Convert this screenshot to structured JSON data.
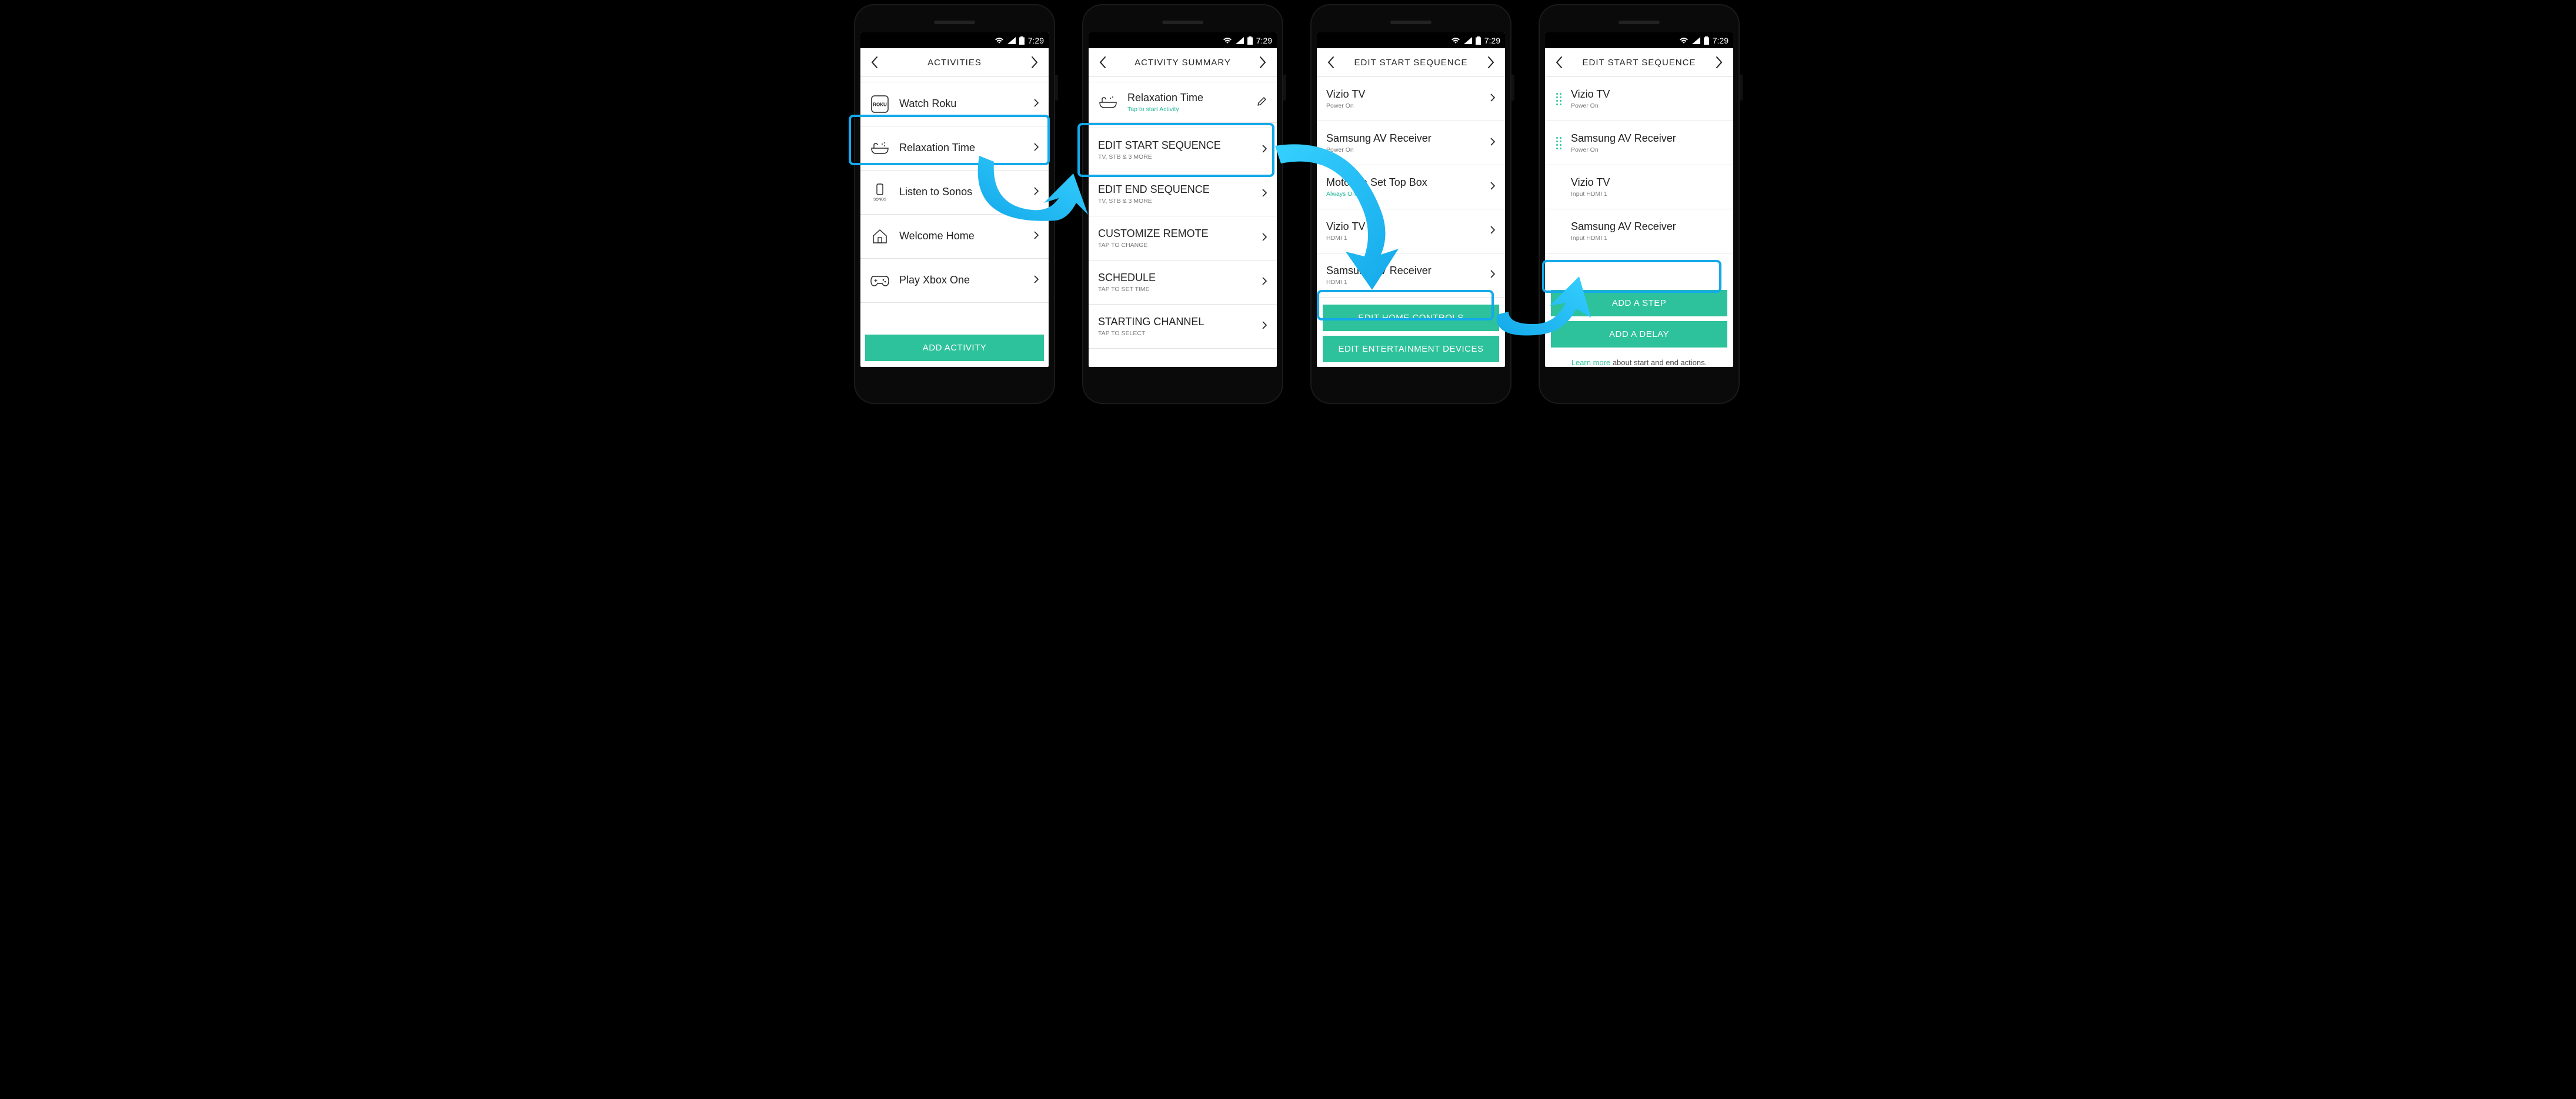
{
  "status": {
    "time": "7:29"
  },
  "colors": {
    "accent": "#2dc29b",
    "highlight": "#14a9ea"
  },
  "screen1": {
    "title": "ACTIVITIES",
    "items": [
      {
        "label": "Watch Roku",
        "icon": "roku"
      },
      {
        "label": "Relaxation Time",
        "icon": "bath"
      },
      {
        "label": "Listen to Sonos",
        "icon": "sonos"
      },
      {
        "label": "Welcome Home",
        "icon": "home"
      },
      {
        "label": "Play Xbox One",
        "icon": "gamepad"
      }
    ],
    "cta": "ADD ACTIVITY"
  },
  "screen2": {
    "title": "ACTIVITY SUMMARY",
    "header_item": {
      "label": "Relaxation Time",
      "sub": "Tap to start Activity",
      "icon": "bath"
    },
    "items": [
      {
        "label": "EDIT START SEQUENCE",
        "sub": "TV, STB & 3 MORE"
      },
      {
        "label": "EDIT END SEQUENCE",
        "sub": "TV, STB & 3 MORE"
      },
      {
        "label": "CUSTOMIZE REMOTE",
        "sub": "TAP TO CHANGE"
      },
      {
        "label": "SCHEDULE",
        "sub": "TAP TO SET TIME"
      },
      {
        "label": "STARTING CHANNEL",
        "sub": "TAP TO SELECT"
      }
    ]
  },
  "screen3": {
    "title": "EDIT START SEQUENCE",
    "items": [
      {
        "label": "Vizio TV",
        "sub": "Power On"
      },
      {
        "label": "Samsung AV Receiver",
        "sub": "Power On"
      },
      {
        "label": "Motorola Set Top Box",
        "sub": "Always On",
        "sub_style": "teal"
      },
      {
        "label": "Vizio TV",
        "sub": "HDMI 1"
      },
      {
        "label": "Samsung AV Receiver",
        "sub": "HDMI 1"
      }
    ],
    "buttons": [
      "EDIT HOME CONTROLS",
      "EDIT ENTERTAINMENT DEVICES"
    ]
  },
  "screen4": {
    "title": "EDIT START SEQUENCE",
    "items": [
      {
        "label": "Vizio TV",
        "sub": "Power On",
        "reorder": true
      },
      {
        "label": "Samsung AV Receiver",
        "sub": "Power On",
        "reorder": true
      },
      {
        "label": "Vizio TV",
        "sub": "Input HDMI 1",
        "reorder": false
      },
      {
        "label": "Samsung AV Receiver",
        "sub": "Input HDMI 1",
        "reorder": false
      }
    ],
    "buttons": [
      "ADD A STEP",
      "ADD A DELAY"
    ],
    "footnote_link": "Learn more",
    "footnote_rest": " about start and end actions."
  }
}
